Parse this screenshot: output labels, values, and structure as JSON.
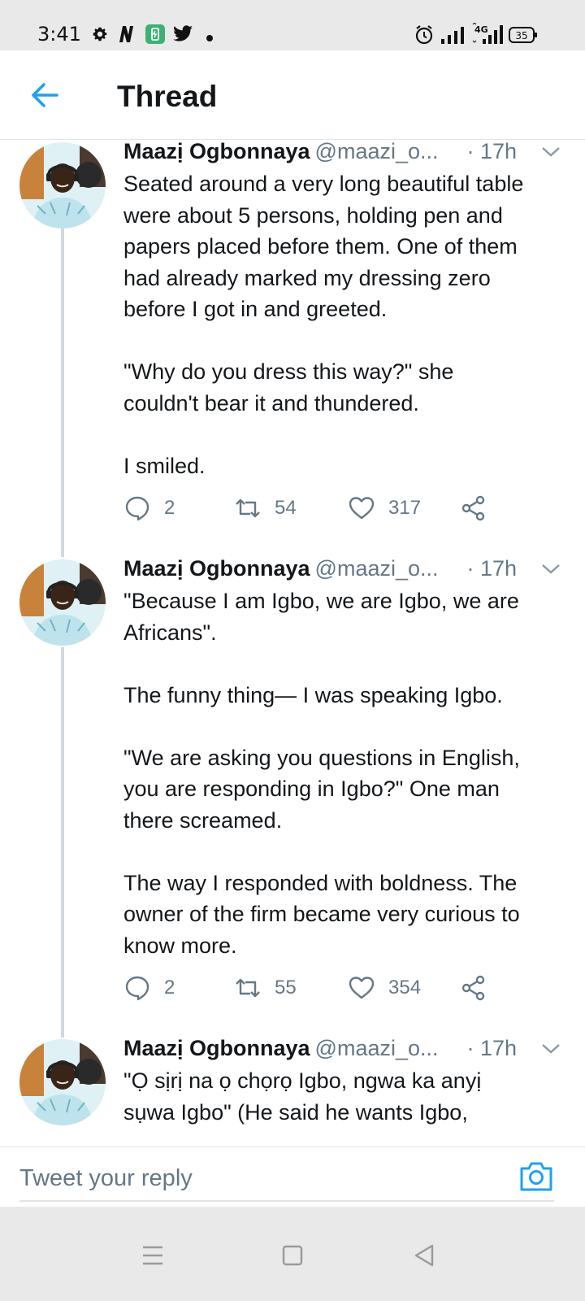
{
  "status_bar": {
    "time": "3:41",
    "left_icons": [
      "gear-icon",
      "netflix-n-icon",
      "battery-saver-icon",
      "twitter-bird-icon",
      "dot-icon"
    ],
    "right_icons": [
      "alarm-icon",
      "signal-icon",
      "4g-signal-icon",
      "battery-icon"
    ],
    "network": "4G",
    "battery_level": "35"
  },
  "header": {
    "title": "Thread",
    "back_icon": "arrow-left-icon"
  },
  "tweets": [
    {
      "name": "Maazị Ogbonnaya",
      "handle": "@maazi_o...",
      "time": "· 17h",
      "text": "Seated around a very long beautiful table\nwere about 5 persons, holding pen and\npapers placed before them. One of them\nhad already marked my dressing zero\nbefore I got in and greeted.\n\n\"Why do you dress this way?\" she\ncouldn't bear it and thundered.\n\nI smiled.",
      "replies": "2",
      "retweets": "54",
      "likes": "317"
    },
    {
      "name": "Maazị Ogbonnaya",
      "handle": "@maazi_o...",
      "time": "· 17h",
      "text": "\"Because I am Igbo, we are Igbo, we are\nAfricans\".\n\nThe funny thing— I was speaking Igbo.\n\n\"We are asking you questions in English,\nyou are responding in Igbo?\" One man\nthere screamed.\n\nThe way I responded with boldness. The\nowner of the firm became very curious to\nknow more.",
      "replies": "2",
      "retweets": "55",
      "likes": "354"
    },
    {
      "name": "Maazị Ogbonnaya",
      "handle": "@maazi_o...",
      "time": "· 17h",
      "text": "\"Ọ sịrị na ọ chọrọ Igbo, ngwa ka anyị\nsụwa Igbo\" (He said he wants Igbo,"
    }
  ],
  "reply_bar": {
    "placeholder": "Tweet your reply",
    "camera_icon": "camera-icon"
  },
  "colors": {
    "accent": "#1da1f2",
    "text": "#14171a",
    "secondary": "#657786",
    "thread_line": "#cfd9de",
    "system_bar": "#e9e9e9"
  }
}
